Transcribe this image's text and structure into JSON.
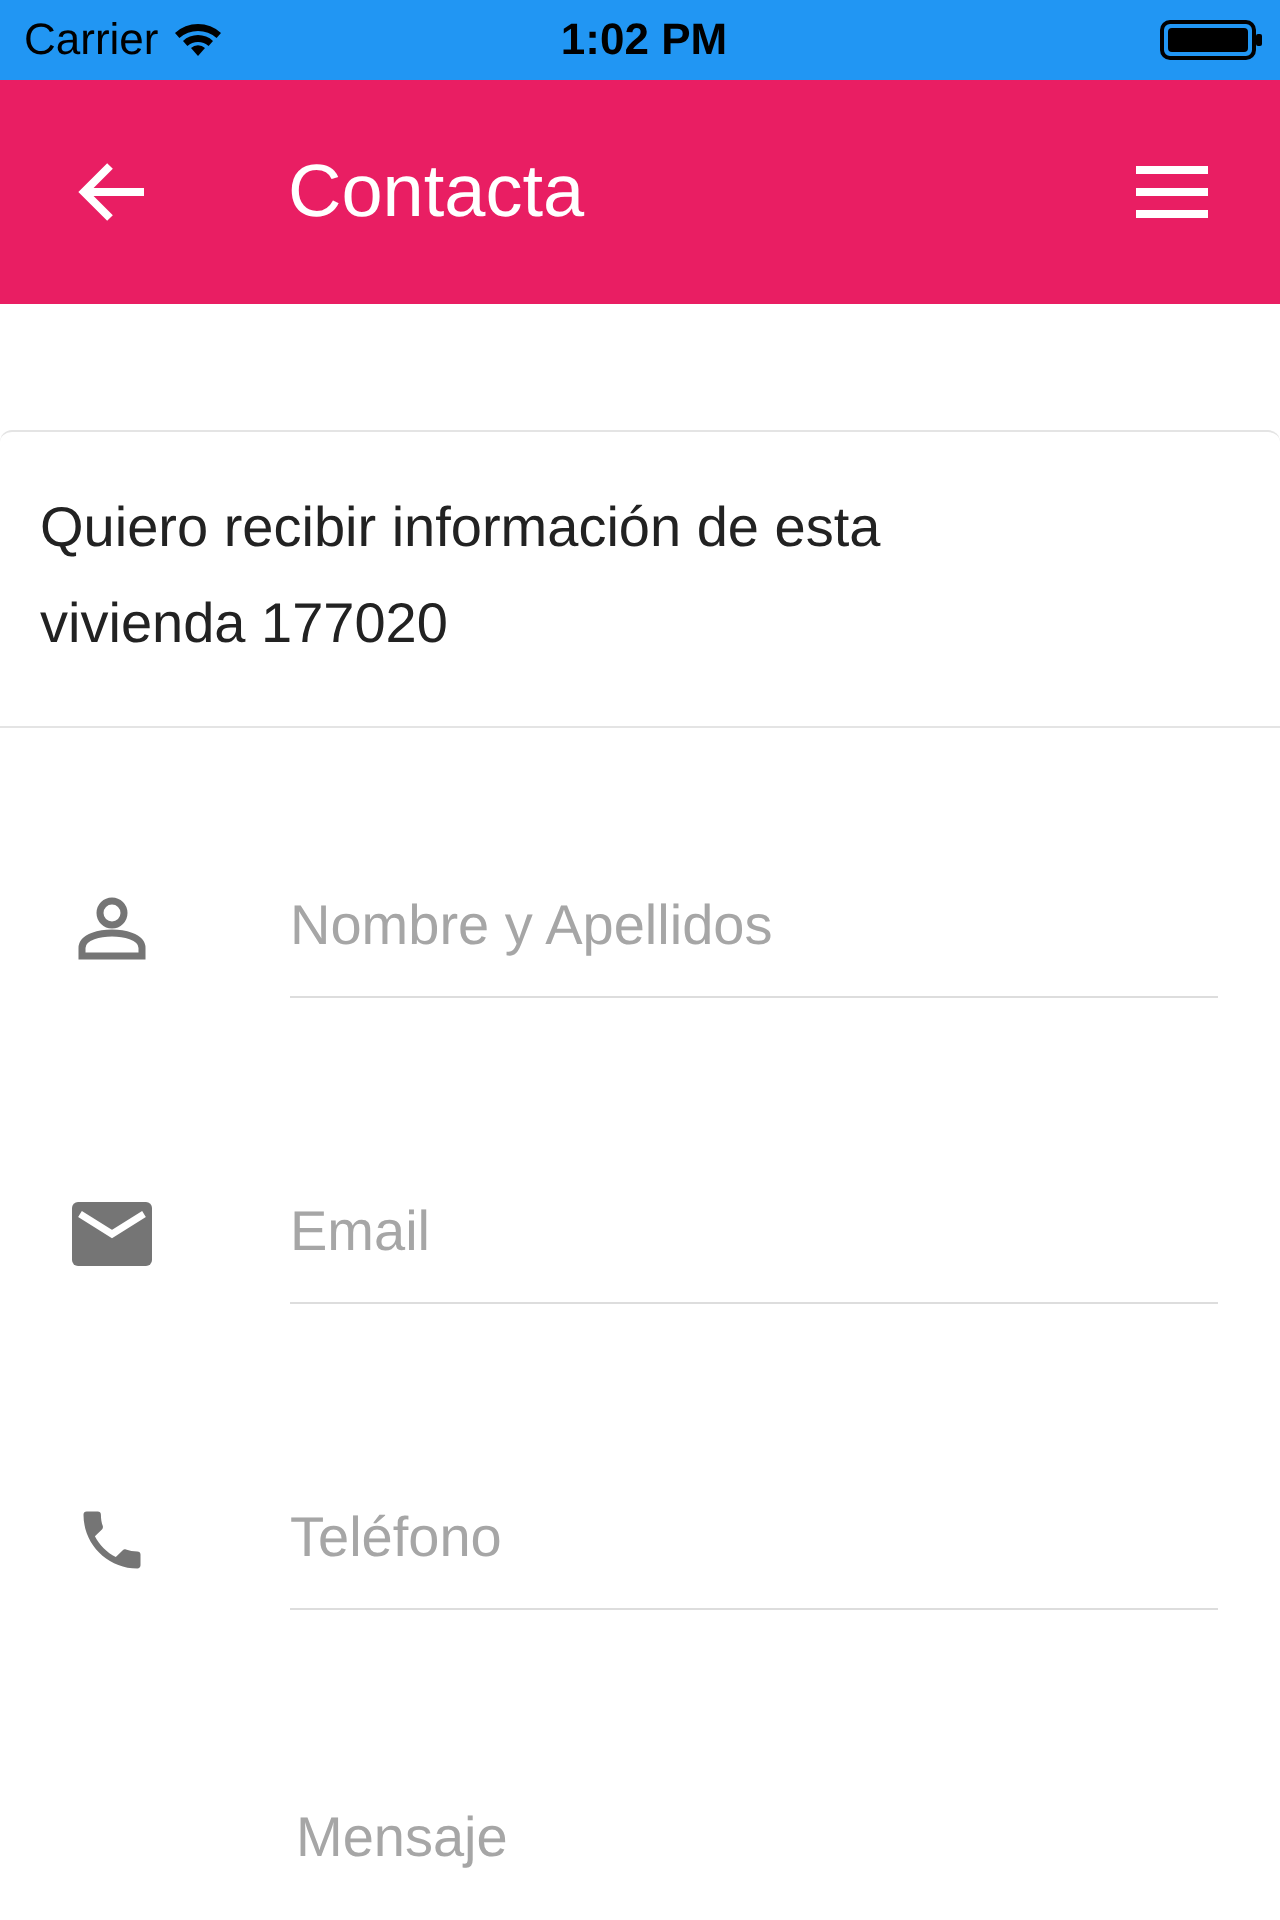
{
  "status_bar": {
    "carrier": "Carrier",
    "time": "1:02 PM"
  },
  "header": {
    "title": "Contacta"
  },
  "message": "Quiero recibir información de esta vivienda 177020",
  "fields": [
    {
      "kind": "person",
      "placeholder": "Nombre y Apellidos"
    },
    {
      "kind": "email",
      "placeholder": "Email"
    },
    {
      "kind": "phone",
      "placeholder": "Teléfono"
    },
    {
      "kind": "textarea",
      "placeholder": "Mensaje"
    }
  ]
}
